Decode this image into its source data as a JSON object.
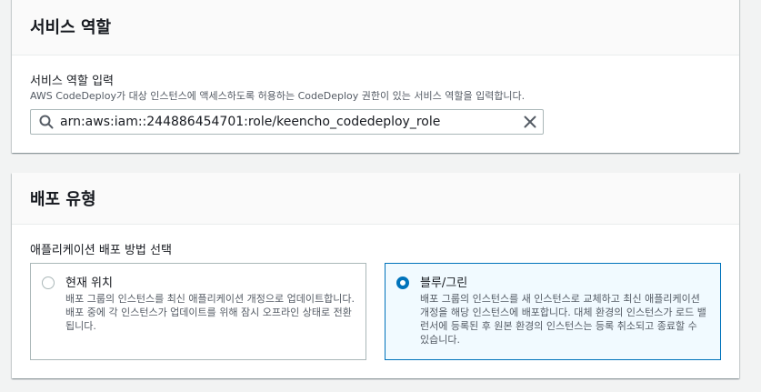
{
  "service_role": {
    "section_title": "서비스 역할",
    "field_label": "서비스 역할 입력",
    "field_description": "AWS CodeDeploy가 대상 인스턴스에 액세스하도록 허용하는 CodeDeploy 권한이 있는 서비스 역할을 입력합니다.",
    "input_value": "arn:aws:iam::244886454701:role/keencho_codedeploy_role"
  },
  "deployment_type": {
    "section_title": "배포 유형",
    "field_label": "애플리케이션 배포 방법 선택",
    "options": [
      {
        "label": "현재 위치",
        "description": "배포 그룹의 인스턴스를 최신 애플리케이션 개정으로 업데이트합니다. 배포 중에 각 인스턴스가 업데이트를 위해 잠시 오프라인 상태로 전환됩니다.",
        "selected": false
      },
      {
        "label": "블루/그린",
        "description": "배포 그룹의 인스턴스를 새 인스턴스로 교체하고 최신 애플리케이션 개정을 해당 인스턴스에 배포합니다. 대체 환경의 인스턴스가 로드 밸런서에 등록된 후 원본 환경의 인스턴스는 등록 취소되고 종료할 수 있습니다.",
        "selected": true
      }
    ]
  },
  "colors": {
    "accent": "#0073bb",
    "selected_tile_bg": "#f1faff",
    "border": "#aab7b8"
  },
  "icons": {
    "search": "search-icon",
    "clear": "close-icon"
  }
}
